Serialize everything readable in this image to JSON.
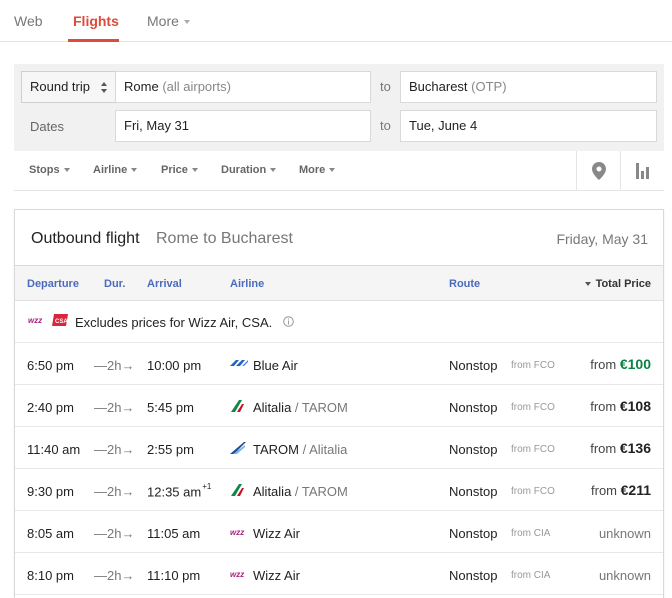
{
  "nav": {
    "tabs": [
      {
        "label": "Web"
      },
      {
        "label": "Flights"
      },
      {
        "label": "More"
      }
    ]
  },
  "search": {
    "trip_type": "Round trip",
    "origin": {
      "city": "Rome",
      "detail": "(all airports)"
    },
    "to_label": "to",
    "destination": {
      "city": "Bucharest",
      "detail": "(OTP)"
    },
    "dates_label": "Dates",
    "depart_date": "Fri, May 31",
    "return_date": "Tue, June 4"
  },
  "filters": [
    {
      "label": "Stops"
    },
    {
      "label": "Airline"
    },
    {
      "label": "Price"
    },
    {
      "label": "Duration"
    },
    {
      "label": "More"
    }
  ],
  "icons": {
    "map": "map-pin-icon",
    "chart": "bar-chart-icon"
  },
  "results": {
    "title": "Outbound flight",
    "route": "Rome to Bucharest",
    "date": "Friday, May 31",
    "columns": {
      "departure": "Departure",
      "duration": "Dur.",
      "arrival": "Arrival",
      "airline": "Airline",
      "route": "Route",
      "total_price": "Total Price"
    },
    "notice": "Excludes prices for Wizz Air, CSA.",
    "flights": [
      {
        "dep": "6:50 pm",
        "dur": "—2h→",
        "arr": "10:00 pm",
        "arr_sup": "",
        "airline": "Blue Air",
        "partner": "",
        "logo": "blue-air",
        "stops": "Nonstop",
        "from": "from FCO",
        "price_prefix": "from",
        "price": "€100"
      },
      {
        "dep": "2:40 pm",
        "dur": "—2h→",
        "arr": "5:45 pm",
        "arr_sup": "",
        "airline": "Alitalia",
        "partner": " / TAROM",
        "logo": "alitalia",
        "stops": "Nonstop",
        "from": "from FCO",
        "price_prefix": "from",
        "price": "€108"
      },
      {
        "dep": "11:40 am",
        "dur": "—2h→",
        "arr": "2:55 pm",
        "arr_sup": "",
        "airline": "TAROM",
        "partner": " / Alitalia",
        "logo": "tarom",
        "stops": "Nonstop",
        "from": "from FCO",
        "price_prefix": "from",
        "price": "€136"
      },
      {
        "dep": "9:30 pm",
        "dur": "—2h→",
        "arr": "12:35 am",
        "arr_sup": "+1",
        "airline": "Alitalia",
        "partner": " / TAROM",
        "logo": "alitalia",
        "stops": "Nonstop",
        "from": "from FCO",
        "price_prefix": "from",
        "price": "€211"
      },
      {
        "dep": "8:05 am",
        "dur": "—2h→",
        "arr": "11:05 am",
        "arr_sup": "",
        "airline": "Wizz Air",
        "partner": "",
        "logo": "wizz",
        "stops": "Nonstop",
        "from": "from CIA",
        "price_prefix": "",
        "price": "unknown"
      },
      {
        "dep": "8:10 pm",
        "dur": "—2h→",
        "arr": "11:10 pm",
        "arr_sup": "",
        "airline": "Wizz Air",
        "partner": "",
        "logo": "wizz",
        "stops": "Nonstop",
        "from": "from CIA",
        "price_prefix": "",
        "price": "unknown"
      }
    ]
  },
  "colors": {
    "accent_red": "#dd4b39",
    "header_blue": "#4a6bbd",
    "best_price_green": "#0b8043"
  }
}
